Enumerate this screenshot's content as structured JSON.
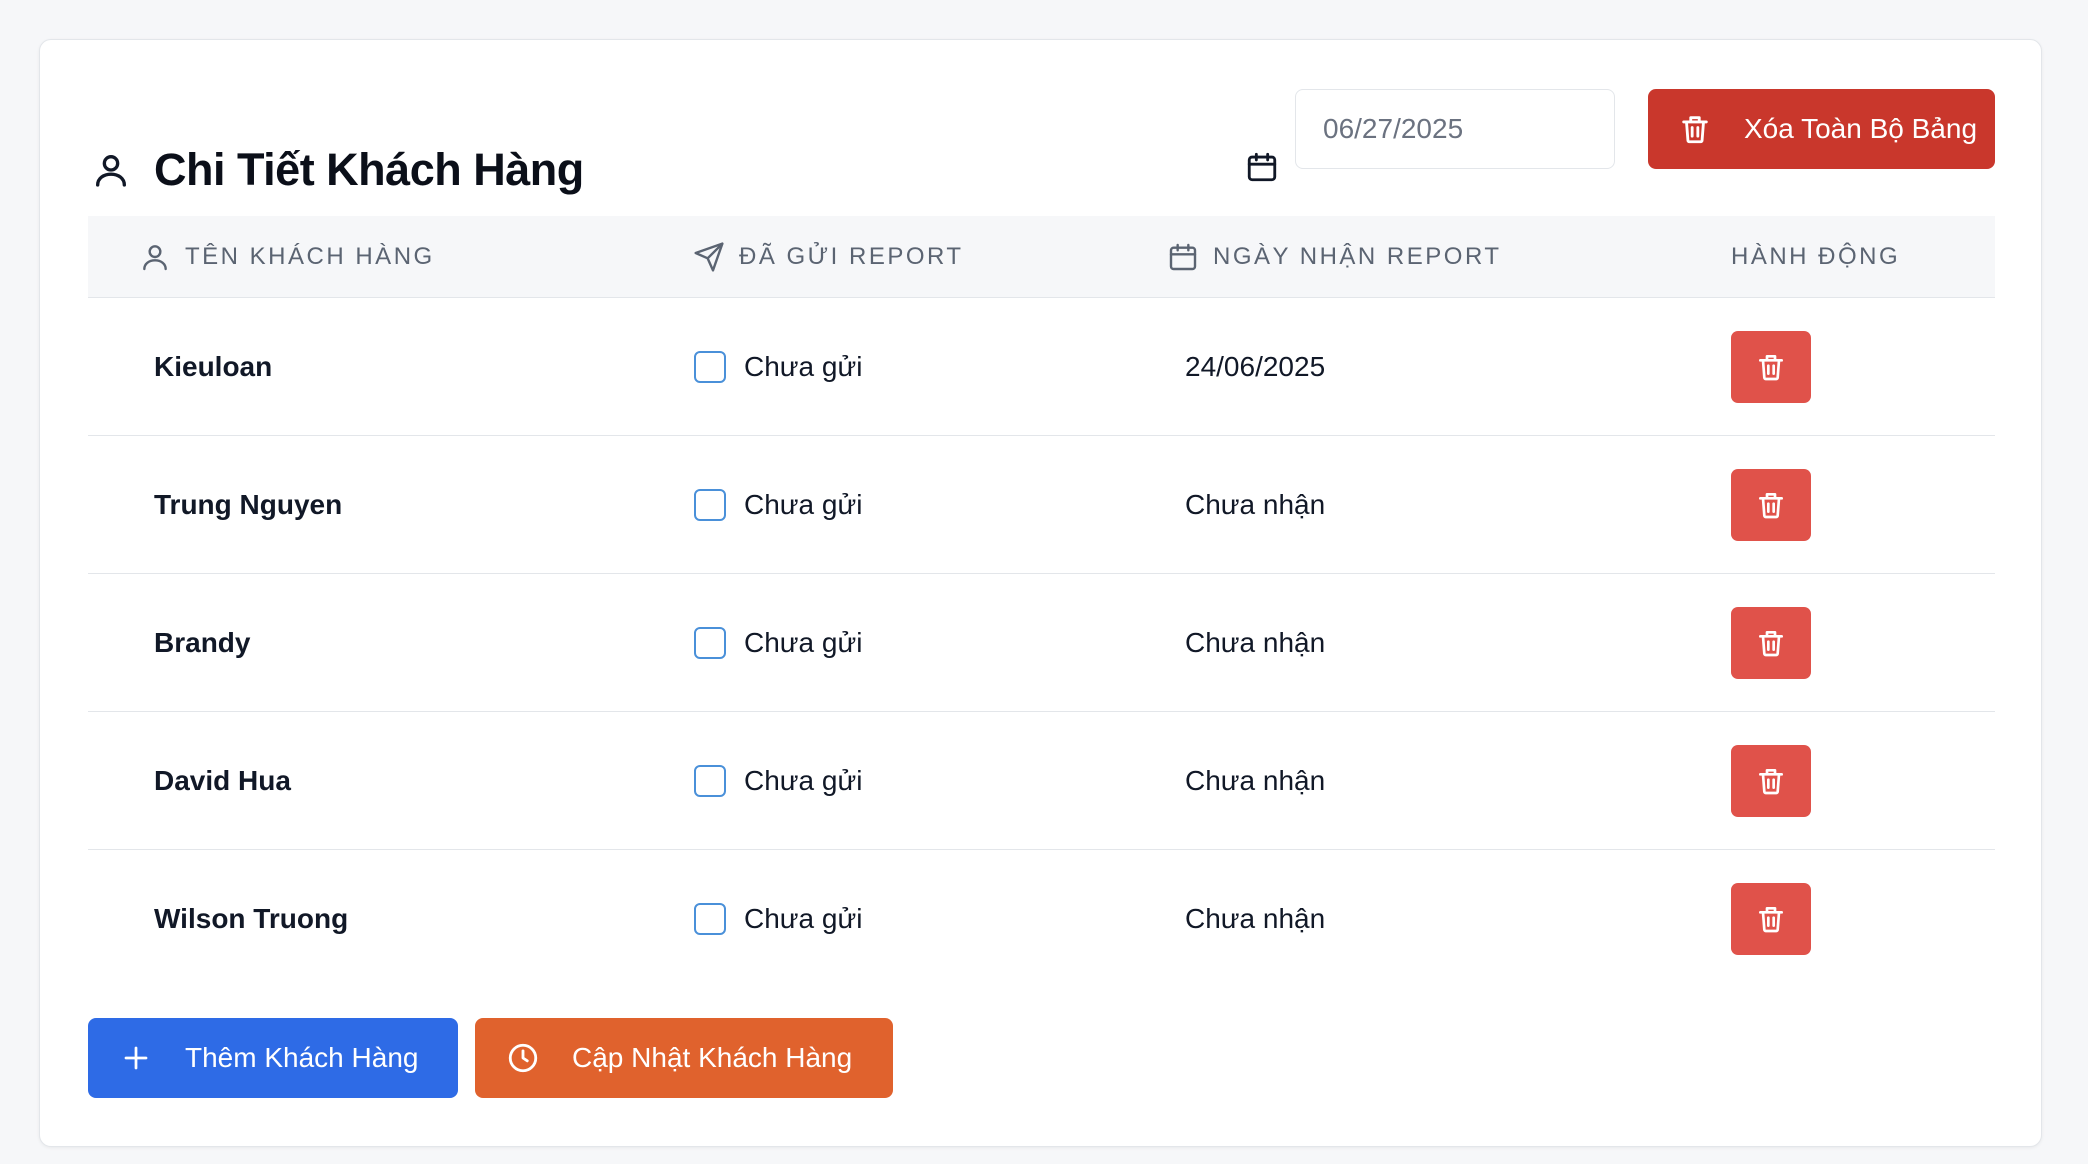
{
  "header": {
    "title": "Chi Tiết Khách Hàng",
    "title_icon": "user-icon",
    "date_icon": "calendar-icon",
    "date_value": "06/27/2025",
    "clear_all_label": "Xóa Toàn Bộ Bảng",
    "clear_all_icon": "trash-icon"
  },
  "table": {
    "columns": [
      {
        "label": "TÊN KHÁCH HÀNG",
        "icon": "user-icon"
      },
      {
        "label": "ĐÃ GỬI REPORT",
        "icon": "send-icon"
      },
      {
        "label": "NGÀY NHẬN REPORT",
        "icon": "calendar-icon"
      },
      {
        "label": "HÀNH ĐỘNG",
        "icon": ""
      }
    ],
    "rows": [
      {
        "name": "Kieuloan",
        "sent_label": "Chưa gửi",
        "sent": false,
        "received_date": "24/06/2025"
      },
      {
        "name": "Trung Nguyen",
        "sent_label": "Chưa gửi",
        "sent": false,
        "received_date": "Chưa nhận"
      },
      {
        "name": "Brandy",
        "sent_label": "Chưa gửi",
        "sent": false,
        "received_date": "Chưa nhận"
      },
      {
        "name": "David Hua",
        "sent_label": "Chưa gửi",
        "sent": false,
        "received_date": "Chưa nhận"
      },
      {
        "name": "Wilson Truong",
        "sent_label": "Chưa gửi",
        "sent": false,
        "received_date": "Chưa nhận"
      }
    ]
  },
  "footer": {
    "add_label": "Thêm Khách Hàng",
    "add_icon": "plus-icon",
    "update_label": "Cập Nhật Khách Hàng",
    "update_icon": "clock-icon"
  },
  "colors": {
    "danger": "#c9372c",
    "row_delete": "#e0524a",
    "primary": "#2e6be6",
    "warning": "#e0622d",
    "checkbox_border": "#4a90d9"
  }
}
